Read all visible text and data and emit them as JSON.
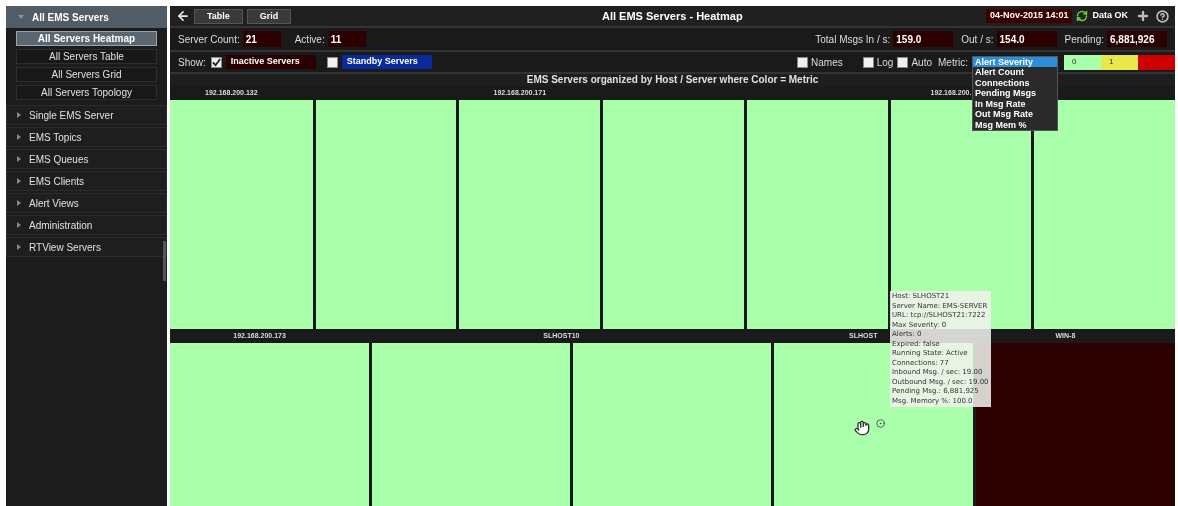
{
  "sidebar": {
    "header": {
      "label": "All EMS Servers",
      "expanded": true
    },
    "subitems": [
      {
        "label": "All Servers Heatmap",
        "selected": true
      },
      {
        "label": "All Servers Table",
        "selected": false
      },
      {
        "label": "All Servers Grid",
        "selected": false
      },
      {
        "label": "All Servers Topology",
        "selected": false
      }
    ],
    "sections": [
      {
        "label": "Single EMS Server"
      },
      {
        "label": "EMS Topics"
      },
      {
        "label": "EMS Queues"
      },
      {
        "label": "EMS Clients"
      },
      {
        "label": "Alert Views"
      },
      {
        "label": "Administration"
      },
      {
        "label": "RTView Servers"
      }
    ]
  },
  "toolbar": {
    "view_buttons": [
      {
        "label": "Table"
      },
      {
        "label": "Grid"
      }
    ],
    "title": "All EMS Servers - Heatmap",
    "datetime": "04-Nov-2015 14:01",
    "status": "Data OK"
  },
  "stats_left": [
    {
      "label": "Server Count:",
      "value": "21"
    },
    {
      "label": "Active:",
      "value": "11"
    }
  ],
  "stats_right": [
    {
      "label": "Total Msgs In / s:",
      "value": "159.0"
    },
    {
      "label": "Out / s:",
      "value": "154.0"
    },
    {
      "label": "Pending:",
      "value": "6,881,926"
    }
  ],
  "filters": {
    "show_label": "Show:",
    "toggles": [
      {
        "label": "Inactive Servers",
        "checked": true,
        "color": "#2a0000"
      },
      {
        "label": "Standby Servers",
        "checked": false,
        "color": "#0a2a9a"
      }
    ],
    "options": [
      {
        "label": "Names",
        "checked": false
      },
      {
        "label": "Log",
        "checked": false
      },
      {
        "label": "Auto",
        "checked": false
      }
    ],
    "metric": {
      "label": "Metric:",
      "expanded": true,
      "options": [
        {
          "label": "Alert Severity",
          "selected": true
        },
        {
          "label": "Alert Count",
          "selected": false
        },
        {
          "label": "Connections",
          "selected": false
        },
        {
          "label": "Pending Msgs",
          "selected": false
        },
        {
          "label": "In Msg Rate",
          "selected": false
        },
        {
          "label": "Out Msg Rate",
          "selected": false
        },
        {
          "label": "Msg Mem %",
          "selected": false
        }
      ]
    },
    "legend": [
      {
        "label": "0",
        "color": "#aaffaa"
      },
      {
        "label": "1",
        "color": "#e8e84a"
      },
      {
        "color": "#cc0000"
      }
    ]
  },
  "heatmap": {
    "title": "EMS Servers organized by Host / Server where Color = Metric",
    "rows": [
      {
        "groups": [
          {
            "label": "192.168.200.132",
            "tiles": [
              {
                "color": "#aaffaa"
              }
            ]
          },
          {
            "label": "192.168.200.171",
            "tiles": [
              {
                "color": "#aaffaa"
              },
              {
                "color": "#aaffaa"
              },
              {
                "color": "#aaffaa"
              }
            ]
          },
          {
            "label": "192.168.200.",
            "tiles": [
              {
                "color": "#aaffaa"
              },
              {
                "color": "#aaffaa"
              },
              {
                "color": "#aaffaa"
              }
            ]
          }
        ]
      },
      {
        "groups": [
          {
            "label": "192.168.200.173",
            "tiles": [
              {
                "color": "#aaffaa"
              }
            ]
          },
          {
            "label": "SLHOST10",
            "tiles": [
              {
                "color": "#aaffaa"
              },
              {
                "color": "#aaffaa"
              }
            ]
          },
          {
            "label": "SLHOST",
            "tiles": [
              {
                "color": "#aaffaa"
              }
            ]
          },
          {
            "label": "WIN-8",
            "tiles": [
              {
                "color": "#2a0000"
              }
            ]
          }
        ]
      }
    ]
  },
  "tooltip": {
    "lines": [
      "Host: SLHOST21",
      "Server Name: EMS-SERVER",
      "URL: tcp://SLHOST21:7222",
      "Max Severity: 0",
      "Alerts: 0",
      "Expired: false",
      "Running State: Active",
      "Connections: 77",
      "Inbound Msg. / sec: 19.00",
      "Outbound Msg. / sec: 19.00",
      "Pending Msg.: 6,881,925",
      "Msg. Memory %: 100.0"
    ]
  }
}
